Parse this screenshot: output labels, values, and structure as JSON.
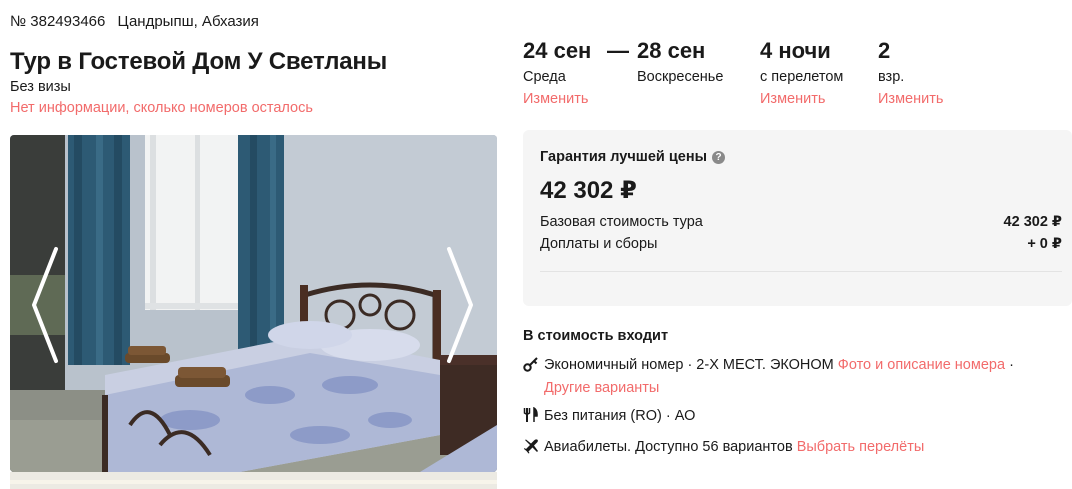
{
  "tour": {
    "number": "№ 382493466",
    "location": "Цандрыпш, Абхазия",
    "title": "Тур в Гостевой Дом У Светланы",
    "visa": "Без визы",
    "rooms_note": "Нет информации, сколько номеров осталось"
  },
  "dates": {
    "from_date": "24 сен",
    "separator": "—",
    "from_day": "Среда",
    "change_link": "Изменить",
    "to_date": "28 сен",
    "to_day": "Воскресенье",
    "nights": "4 ночи",
    "nights_sub": "с перелетом",
    "nights_link": "Изменить",
    "adults": "2",
    "adults_sub": "взр.",
    "adults_link": "Изменить"
  },
  "price": {
    "guarantee": "Гарантия лучшей цены",
    "total": "42 302 ₽",
    "base_label": "Базовая стоимость тура",
    "base_value": "42 302 ₽",
    "extras_label": "Доплаты и сборы",
    "extras_value": "+ 0 ₽"
  },
  "includes": {
    "title": "В стоимость входит",
    "room_text": "Экономичный номер · 2-Х МЕСТ. ЭКОНОМ",
    "room_link": "Фото и описание номера",
    "room_sep": "·",
    "room_alt_link": "Другие варианты",
    "meal_text": "Без питания (RO) · АО",
    "flight_text": "Авиабилеты. Доступно 56 вариантов",
    "flight_link": "Выбрать перелёты"
  },
  "icons": {
    "info": "info-icon",
    "prev": "chevron-left-icon",
    "next": "chevron-right-icon",
    "room": "key-icon",
    "meal": "cutlery-icon",
    "flight": "airplane-icon"
  },
  "colors": {
    "accent": "#f26b6b",
    "card_bg": "#f5f5f5",
    "text": "#1a1a1a"
  }
}
